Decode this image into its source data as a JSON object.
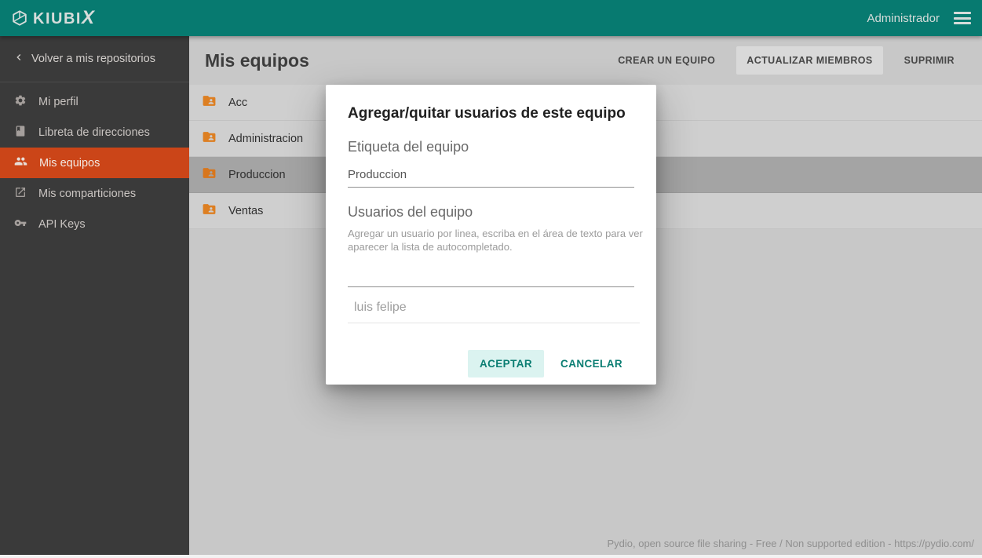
{
  "topbar": {
    "brand": "KIUBI",
    "brand_x": "X",
    "user": "Administrador"
  },
  "sidebar": {
    "back_label": "Volver a mis repositorios",
    "items": [
      {
        "label": "Mi perfil",
        "icon": "gear-icon",
        "active": false
      },
      {
        "label": "Libreta de direcciones",
        "icon": "book-icon",
        "active": false
      },
      {
        "label": "Mis equipos",
        "icon": "people-icon",
        "active": true
      },
      {
        "label": "Mis comparticiones",
        "icon": "share-icon",
        "active": false
      },
      {
        "label": "API Keys",
        "icon": "key-icon",
        "active": false
      }
    ]
  },
  "main": {
    "title": "Mis equipos",
    "actions": [
      {
        "label": "CREAR UN EQUIPO",
        "highlighted": false
      },
      {
        "label": "ACTUALIZAR MIEMBROS",
        "highlighted": true
      },
      {
        "label": "SUPRIMIR",
        "highlighted": false
      }
    ],
    "teams": [
      {
        "name": "Acc",
        "selected": false
      },
      {
        "name": "Administracion",
        "selected": false
      },
      {
        "name": "Produccion",
        "selected": true
      },
      {
        "name": "Ventas",
        "selected": false
      }
    ],
    "footer": "Pydio, open source file sharing - Free / Non supported edition - https://pydio.com/"
  },
  "modal": {
    "title": "Agregar/quitar usuarios de este equipo",
    "label_field": {
      "label": "Etiqueta del equipo",
      "value": "Produccion"
    },
    "users_section": {
      "label": "Usuarios del equipo",
      "help": "Agregar un usuario por linea, escriba en el área de texto para ver aparecer la lista de autocompletado.",
      "textarea_value": "",
      "autocomplete_placeholder": "luis felipe"
    },
    "buttons": {
      "accept": "ACEPTAR",
      "cancel": "CANCELAR"
    }
  },
  "colors": {
    "topbar_teal": "#077a70",
    "sidebar_dark": "#3a3a3a",
    "accent_orange": "#cb4518",
    "accent_teal": "#0b7e73",
    "folder_orange": "#dd7f22",
    "selected_row_gray": "#a4a4a4"
  }
}
